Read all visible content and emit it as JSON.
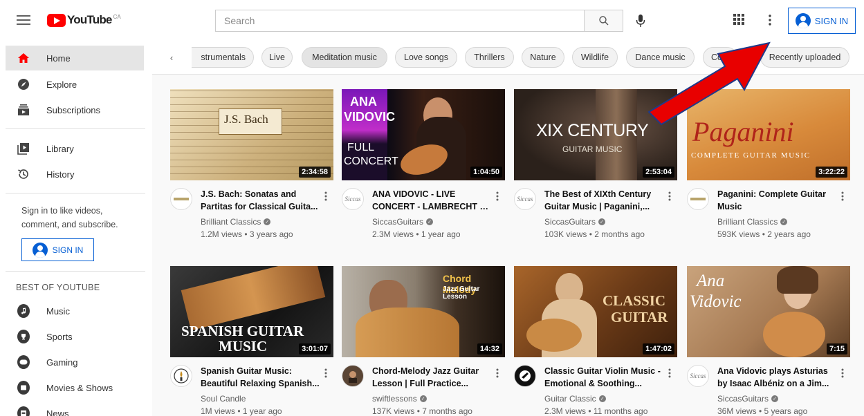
{
  "header": {
    "logo_text": "YouTube",
    "logo_region": "CA",
    "search_placeholder": "Search",
    "signin_label": "SIGN IN"
  },
  "sidebar": {
    "items": [
      {
        "label": "Home",
        "icon": "home-icon",
        "active": true
      },
      {
        "label": "Explore",
        "icon": "compass-icon"
      },
      {
        "label": "Subscriptions",
        "icon": "subscriptions-icon"
      },
      {
        "label": "Library",
        "icon": "library-icon"
      },
      {
        "label": "History",
        "icon": "history-icon"
      }
    ],
    "signin_prompt": "Sign in to like videos, comment, and subscribe.",
    "signin_label": "SIGN IN",
    "best_of_title": "BEST OF YOUTUBE",
    "best_of": [
      {
        "label": "Music",
        "icon": "music-icon"
      },
      {
        "label": "Sports",
        "icon": "trophy-icon"
      },
      {
        "label": "Gaming",
        "icon": "gaming-icon"
      },
      {
        "label": "Movies & Shows",
        "icon": "movies-icon"
      },
      {
        "label": "News",
        "icon": "news-icon"
      }
    ]
  },
  "chips": [
    "strumentals",
    "Live",
    "Meditation music",
    "Love songs",
    "Thrillers",
    "Nature",
    "Wildlife",
    "Dance music",
    "Co",
    "Recently uploaded"
  ],
  "videos": [
    {
      "title1": "J.S. Bach: Sonatas and",
      "title2": "Partitas for Classical Guita...",
      "channel": "Brilliant Classics",
      "meta": "1.2M views • 3 years ago",
      "duration": "2:34:58"
    },
    {
      "title1": "ANA VIDOVIC - LIVE",
      "title2": "CONCERT - LAMBRECHT –...",
      "channel": "SiccasGuitars",
      "meta": "2.3M views • 1 year ago",
      "duration": "1:04:50"
    },
    {
      "title1": "The Best of XIXth Century",
      "title2": "Guitar Music | Paganini,...",
      "channel": "SiccasGuitars",
      "meta": "103K views • 2 months ago",
      "duration": "2:53:04"
    },
    {
      "title1": "Paganini: Complete Guitar",
      "title2": "Music",
      "channel": "Brilliant Classics",
      "meta": "593K views • 2 years ago",
      "duration": "3:22:22"
    },
    {
      "title1": "Spanish Guitar Music:",
      "title2": "Beautiful Relaxing Spanish...",
      "channel": "Soul Candle",
      "meta": "1M views • 1 year ago",
      "duration": "3:01:07"
    },
    {
      "title1": "Chord-Melody Jazz Guitar",
      "title2": "Lesson | Full Practice...",
      "channel": "swiftlessons",
      "meta": "137K views • 7 months ago",
      "duration": "14:32"
    },
    {
      "title1": "Classic Guitar Violin Music -",
      "title2": "Emotional & Soothing...",
      "channel": "Guitar Classic",
      "meta": "2.3M views • 11 months ago",
      "duration": "1:47:02"
    },
    {
      "title1": "Ana Vidovic plays Asturias",
      "title2": "by Isaac Albéniz on a Jim...",
      "channel": "SiccasGuitars",
      "meta": "36M views • 5 years ago",
      "duration": "7:15"
    }
  ],
  "thumb_text": {
    "bach_title": "J.S. Bach",
    "ana_line1": "ANA",
    "ana_line2": "VIDOVIC",
    "ana_line3": "FULL",
    "ana_line4": "CONCERT",
    "xix_line1": "XIX CENTURY",
    "xix_line2": "GUITAR MUSIC",
    "paganini_line1": "Paganini",
    "paganini_line2": "COMPLETE GUITAR MUSIC",
    "spanish_line1": "SPANISH GUITAR",
    "spanish_line2": "MUSIC",
    "chord_line1": "Chord Melody",
    "chord_line2": "Jazz Guitar Lesson",
    "classic_line1": "CLASSIC",
    "classic_line2": "GUITAR",
    "ana2_line1": "Ana",
    "ana2_line2": "Vidovic"
  },
  "colors": {
    "accent": "#065fd4",
    "brand": "#ff0000",
    "arrow": "#e80000"
  }
}
